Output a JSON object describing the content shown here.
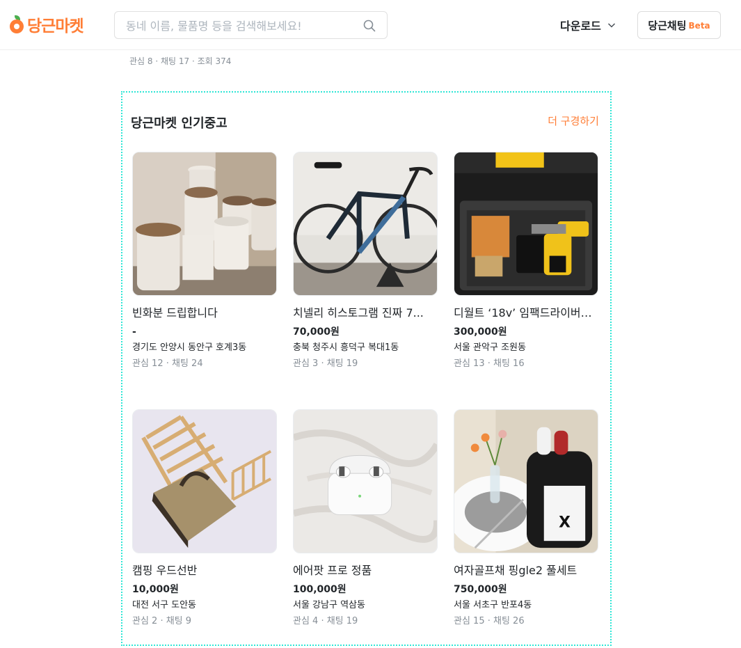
{
  "header": {
    "logo_text": "당근마켓",
    "search_placeholder": "동네 이름, 물품명 등을 검색해보세요!",
    "download_label": "다운로드",
    "chat_label": "당근채팅",
    "chat_badge": "Beta",
    "accent_color": "#ff7e36"
  },
  "previous_article": {
    "counts": "관심 8 · 채팅 17 · 조회 374"
  },
  "popular": {
    "title": "당근마켓 인기중고",
    "more_label": "더 구경하기",
    "items": [
      {
        "title": "빈화분 드립합니다",
        "price": "-",
        "region": "경기도 안양시 동안구 호계3동",
        "counts": "관심 12 · 채팅 24",
        "image": "empty flower pots"
      },
      {
        "title": "치넬리 히스토그램 진짜 7...",
        "price": "70,000원",
        "region": "충북 청주시 흥덕구 복대1동",
        "counts": "관심 3 · 채팅 19",
        "image": "bicycle on stand"
      },
      {
        "title": "디월트 ‘18v’ 임팩드라이버+...",
        "price": "300,000원",
        "region": "서울 관악구 조원동",
        "counts": "관심 13 · 채팅 16",
        "image": "power drill in toolbox"
      },
      {
        "title": "캠핑 우드선반",
        "price": "10,000원",
        "region": "대전 서구 도안동",
        "counts": "관심 2 · 채팅 9",
        "image": "wooden camping shelves"
      },
      {
        "title": "에어팟 프로 정품",
        "price": "100,000원",
        "region": "서울 강남구 역삼동",
        "counts": "관심 4 · 채팅 19",
        "image": "airpods pro case"
      },
      {
        "title": "여자골프채 핑gle2 풀세트",
        "price": "750,000원",
        "region": "서울 서초구 반포4동",
        "counts": "관심 15 · 채팅 26",
        "image": "golf bag with clubs"
      }
    ]
  }
}
